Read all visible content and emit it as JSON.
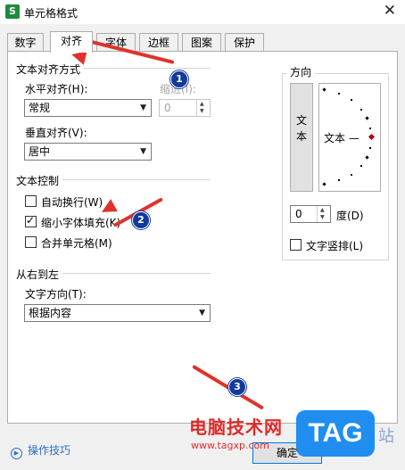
{
  "window": {
    "icon_letter": "S",
    "title": "单元格格式",
    "close": "✕"
  },
  "tabs": [
    {
      "label": "数字",
      "active": false
    },
    {
      "label": "对齐",
      "active": true
    },
    {
      "label": "字体",
      "active": false
    },
    {
      "label": "边框",
      "active": false
    },
    {
      "label": "图案",
      "active": false
    },
    {
      "label": "保护",
      "active": false
    }
  ],
  "alignment": {
    "title": "文本对齐方式",
    "horizontal_label": "水平对齐(H):",
    "horizontal_value": "常规",
    "indent_label": "缩进(I):",
    "indent_value": "0",
    "vertical_label": "垂直对齐(V):",
    "vertical_value": "居中"
  },
  "text_control": {
    "title": "文本控制",
    "wrap_label": "自动换行(W)",
    "wrap_checked": false,
    "shrink_label": "缩小字体填充(K)",
    "shrink_checked": true,
    "merge_label": "合并单元格(M)",
    "merge_checked": false
  },
  "rtl": {
    "title": "从右到左",
    "direction_label": "文字方向(T):",
    "direction_value": "根据内容"
  },
  "orientation": {
    "title": "方向",
    "vertical_text": "文本",
    "dial_text": "文本 —",
    "degree_value": "0",
    "degree_label": "度(D)",
    "vertical_stack_label": "文字竖排(L)",
    "vertical_stack_checked": false
  },
  "annotations": {
    "badge1": "1",
    "badge2": "2",
    "badge3": "3"
  },
  "watermark": {
    "site_name": "电脑技术网",
    "url": "www.tagxp.com",
    "logo": "TAG",
    "suffix": "站"
  },
  "footer": {
    "tips_label": "操作技巧",
    "ok_label": "确定"
  },
  "colors": {
    "accent_red": "#e0322b",
    "badge_blue": "#123a9c",
    "tips_blue": "#2a6fc9"
  }
}
